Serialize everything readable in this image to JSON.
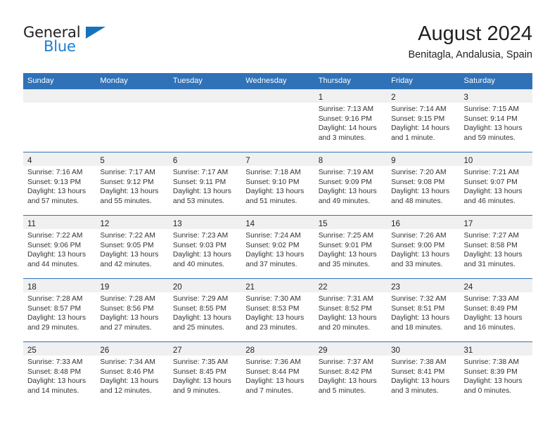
{
  "brand": {
    "word_one": "General",
    "word_two": "Blue",
    "logo_icon": "triangle-icon",
    "color_dark": "#231f20",
    "color_blue": "#1b7fd4"
  },
  "header": {
    "title": "August 2024",
    "subtitle": "Benitagla, Andalusia, Spain"
  },
  "theme": {
    "header_blue": "#3072b8",
    "band_gray": "#f0f0f0",
    "text": "#231f20"
  },
  "calendar": {
    "weekday_headers": [
      "Sunday",
      "Monday",
      "Tuesday",
      "Wednesday",
      "Thursday",
      "Friday",
      "Saturday"
    ],
    "weeks": [
      [
        {
          "day": "",
          "sunrise": "",
          "sunset": "",
          "daylight_1": "",
          "daylight_2": ""
        },
        {
          "day": "",
          "sunrise": "",
          "sunset": "",
          "daylight_1": "",
          "daylight_2": ""
        },
        {
          "day": "",
          "sunrise": "",
          "sunset": "",
          "daylight_1": "",
          "daylight_2": ""
        },
        {
          "day": "",
          "sunrise": "",
          "sunset": "",
          "daylight_1": "",
          "daylight_2": ""
        },
        {
          "day": "1",
          "sunrise": "Sunrise: 7:13 AM",
          "sunset": "Sunset: 9:16 PM",
          "daylight_1": "Daylight: 14 hours",
          "daylight_2": "and 3 minutes."
        },
        {
          "day": "2",
          "sunrise": "Sunrise: 7:14 AM",
          "sunset": "Sunset: 9:15 PM",
          "daylight_1": "Daylight: 14 hours",
          "daylight_2": "and 1 minute."
        },
        {
          "day": "3",
          "sunrise": "Sunrise: 7:15 AM",
          "sunset": "Sunset: 9:14 PM",
          "daylight_1": "Daylight: 13 hours",
          "daylight_2": "and 59 minutes."
        }
      ],
      [
        {
          "day": "4",
          "sunrise": "Sunrise: 7:16 AM",
          "sunset": "Sunset: 9:13 PM",
          "daylight_1": "Daylight: 13 hours",
          "daylight_2": "and 57 minutes."
        },
        {
          "day": "5",
          "sunrise": "Sunrise: 7:17 AM",
          "sunset": "Sunset: 9:12 PM",
          "daylight_1": "Daylight: 13 hours",
          "daylight_2": "and 55 minutes."
        },
        {
          "day": "6",
          "sunrise": "Sunrise: 7:17 AM",
          "sunset": "Sunset: 9:11 PM",
          "daylight_1": "Daylight: 13 hours",
          "daylight_2": "and 53 minutes."
        },
        {
          "day": "7",
          "sunrise": "Sunrise: 7:18 AM",
          "sunset": "Sunset: 9:10 PM",
          "daylight_1": "Daylight: 13 hours",
          "daylight_2": "and 51 minutes."
        },
        {
          "day": "8",
          "sunrise": "Sunrise: 7:19 AM",
          "sunset": "Sunset: 9:09 PM",
          "daylight_1": "Daylight: 13 hours",
          "daylight_2": "and 49 minutes."
        },
        {
          "day": "9",
          "sunrise": "Sunrise: 7:20 AM",
          "sunset": "Sunset: 9:08 PM",
          "daylight_1": "Daylight: 13 hours",
          "daylight_2": "and 48 minutes."
        },
        {
          "day": "10",
          "sunrise": "Sunrise: 7:21 AM",
          "sunset": "Sunset: 9:07 PM",
          "daylight_1": "Daylight: 13 hours",
          "daylight_2": "and 46 minutes."
        }
      ],
      [
        {
          "day": "11",
          "sunrise": "Sunrise: 7:22 AM",
          "sunset": "Sunset: 9:06 PM",
          "daylight_1": "Daylight: 13 hours",
          "daylight_2": "and 44 minutes."
        },
        {
          "day": "12",
          "sunrise": "Sunrise: 7:22 AM",
          "sunset": "Sunset: 9:05 PM",
          "daylight_1": "Daylight: 13 hours",
          "daylight_2": "and 42 minutes."
        },
        {
          "day": "13",
          "sunrise": "Sunrise: 7:23 AM",
          "sunset": "Sunset: 9:03 PM",
          "daylight_1": "Daylight: 13 hours",
          "daylight_2": "and 40 minutes."
        },
        {
          "day": "14",
          "sunrise": "Sunrise: 7:24 AM",
          "sunset": "Sunset: 9:02 PM",
          "daylight_1": "Daylight: 13 hours",
          "daylight_2": "and 37 minutes."
        },
        {
          "day": "15",
          "sunrise": "Sunrise: 7:25 AM",
          "sunset": "Sunset: 9:01 PM",
          "daylight_1": "Daylight: 13 hours",
          "daylight_2": "and 35 minutes."
        },
        {
          "day": "16",
          "sunrise": "Sunrise: 7:26 AM",
          "sunset": "Sunset: 9:00 PM",
          "daylight_1": "Daylight: 13 hours",
          "daylight_2": "and 33 minutes."
        },
        {
          "day": "17",
          "sunrise": "Sunrise: 7:27 AM",
          "sunset": "Sunset: 8:58 PM",
          "daylight_1": "Daylight: 13 hours",
          "daylight_2": "and 31 minutes."
        }
      ],
      [
        {
          "day": "18",
          "sunrise": "Sunrise: 7:28 AM",
          "sunset": "Sunset: 8:57 PM",
          "daylight_1": "Daylight: 13 hours",
          "daylight_2": "and 29 minutes."
        },
        {
          "day": "19",
          "sunrise": "Sunrise: 7:28 AM",
          "sunset": "Sunset: 8:56 PM",
          "daylight_1": "Daylight: 13 hours",
          "daylight_2": "and 27 minutes."
        },
        {
          "day": "20",
          "sunrise": "Sunrise: 7:29 AM",
          "sunset": "Sunset: 8:55 PM",
          "daylight_1": "Daylight: 13 hours",
          "daylight_2": "and 25 minutes."
        },
        {
          "day": "21",
          "sunrise": "Sunrise: 7:30 AM",
          "sunset": "Sunset: 8:53 PM",
          "daylight_1": "Daylight: 13 hours",
          "daylight_2": "and 23 minutes."
        },
        {
          "day": "22",
          "sunrise": "Sunrise: 7:31 AM",
          "sunset": "Sunset: 8:52 PM",
          "daylight_1": "Daylight: 13 hours",
          "daylight_2": "and 20 minutes."
        },
        {
          "day": "23",
          "sunrise": "Sunrise: 7:32 AM",
          "sunset": "Sunset: 8:51 PM",
          "daylight_1": "Daylight: 13 hours",
          "daylight_2": "and 18 minutes."
        },
        {
          "day": "24",
          "sunrise": "Sunrise: 7:33 AM",
          "sunset": "Sunset: 8:49 PM",
          "daylight_1": "Daylight: 13 hours",
          "daylight_2": "and 16 minutes."
        }
      ],
      [
        {
          "day": "25",
          "sunrise": "Sunrise: 7:33 AM",
          "sunset": "Sunset: 8:48 PM",
          "daylight_1": "Daylight: 13 hours",
          "daylight_2": "and 14 minutes."
        },
        {
          "day": "26",
          "sunrise": "Sunrise: 7:34 AM",
          "sunset": "Sunset: 8:46 PM",
          "daylight_1": "Daylight: 13 hours",
          "daylight_2": "and 12 minutes."
        },
        {
          "day": "27",
          "sunrise": "Sunrise: 7:35 AM",
          "sunset": "Sunset: 8:45 PM",
          "daylight_1": "Daylight: 13 hours",
          "daylight_2": "and 9 minutes."
        },
        {
          "day": "28",
          "sunrise": "Sunrise: 7:36 AM",
          "sunset": "Sunset: 8:44 PM",
          "daylight_1": "Daylight: 13 hours",
          "daylight_2": "and 7 minutes."
        },
        {
          "day": "29",
          "sunrise": "Sunrise: 7:37 AM",
          "sunset": "Sunset: 8:42 PM",
          "daylight_1": "Daylight: 13 hours",
          "daylight_2": "and 5 minutes."
        },
        {
          "day": "30",
          "sunrise": "Sunrise: 7:38 AM",
          "sunset": "Sunset: 8:41 PM",
          "daylight_1": "Daylight: 13 hours",
          "daylight_2": "and 3 minutes."
        },
        {
          "day": "31",
          "sunrise": "Sunrise: 7:38 AM",
          "sunset": "Sunset: 8:39 PM",
          "daylight_1": "Daylight: 13 hours",
          "daylight_2": "and 0 minutes."
        }
      ]
    ]
  }
}
